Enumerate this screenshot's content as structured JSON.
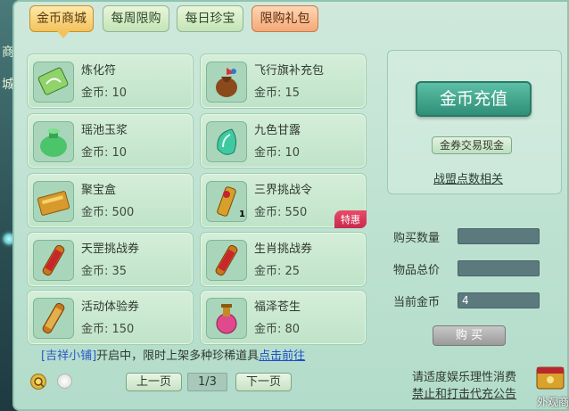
{
  "side": {
    "chars": [
      "商",
      "城"
    ]
  },
  "tabs": [
    {
      "label": "金币商城",
      "state": "active"
    },
    {
      "label": "每周限购",
      "state": "normal"
    },
    {
      "label": "每日珍宝",
      "state": "normal"
    },
    {
      "label": "限购礼包",
      "state": "gift"
    }
  ],
  "items": [
    {
      "name": "炼化符",
      "price": "金币: 10",
      "icon": "talisman-icon"
    },
    {
      "name": "飞行旗补充包",
      "price": "金币: 15",
      "icon": "flag-bag-icon"
    },
    {
      "name": "瑶池玉浆",
      "price": "金币: 10",
      "icon": "jade-jar-icon"
    },
    {
      "name": "九色甘露",
      "price": "金币: 10",
      "icon": "nectar-icon"
    },
    {
      "name": "聚宝盒",
      "price": "金币: 500",
      "icon": "treasure-box-icon"
    },
    {
      "name": "三界挑战令",
      "price": "金币: 550",
      "icon": "challenge-token-icon",
      "badge": "特惠",
      "count": "1"
    },
    {
      "name": "天罡挑战券",
      "price": "金币: 35",
      "icon": "scroll-icon"
    },
    {
      "name": "生肖挑战券",
      "price": "金币: 25",
      "icon": "scroll-icon"
    },
    {
      "name": "活动体验券",
      "price": "金币: 150",
      "icon": "scroll-icon"
    },
    {
      "name": "福泽苍生",
      "price": "金币: 80",
      "icon": "potion-icon"
    }
  ],
  "right": {
    "recharge": "金币充值",
    "exchange": "金券交易现金",
    "points": "战盟点数相关",
    "qty_label": "购买数量",
    "total_label": "物品总价",
    "gold_label": "当前金币",
    "qty_value": "",
    "total_value": "",
    "gold_value": "4",
    "buy": "购 买"
  },
  "notice": {
    "shop": "[吉祥小铺]",
    "text": "开启中，限时上架多种珍稀道具",
    "link": "点击前往"
  },
  "pager": {
    "prev": "上一页",
    "page": "1/3",
    "next": "下一页"
  },
  "health": {
    "line1": "请适度娱乐理性消费",
    "line2": "禁止和打击代充公告"
  },
  "outfit": {
    "label": "外观商"
  }
}
